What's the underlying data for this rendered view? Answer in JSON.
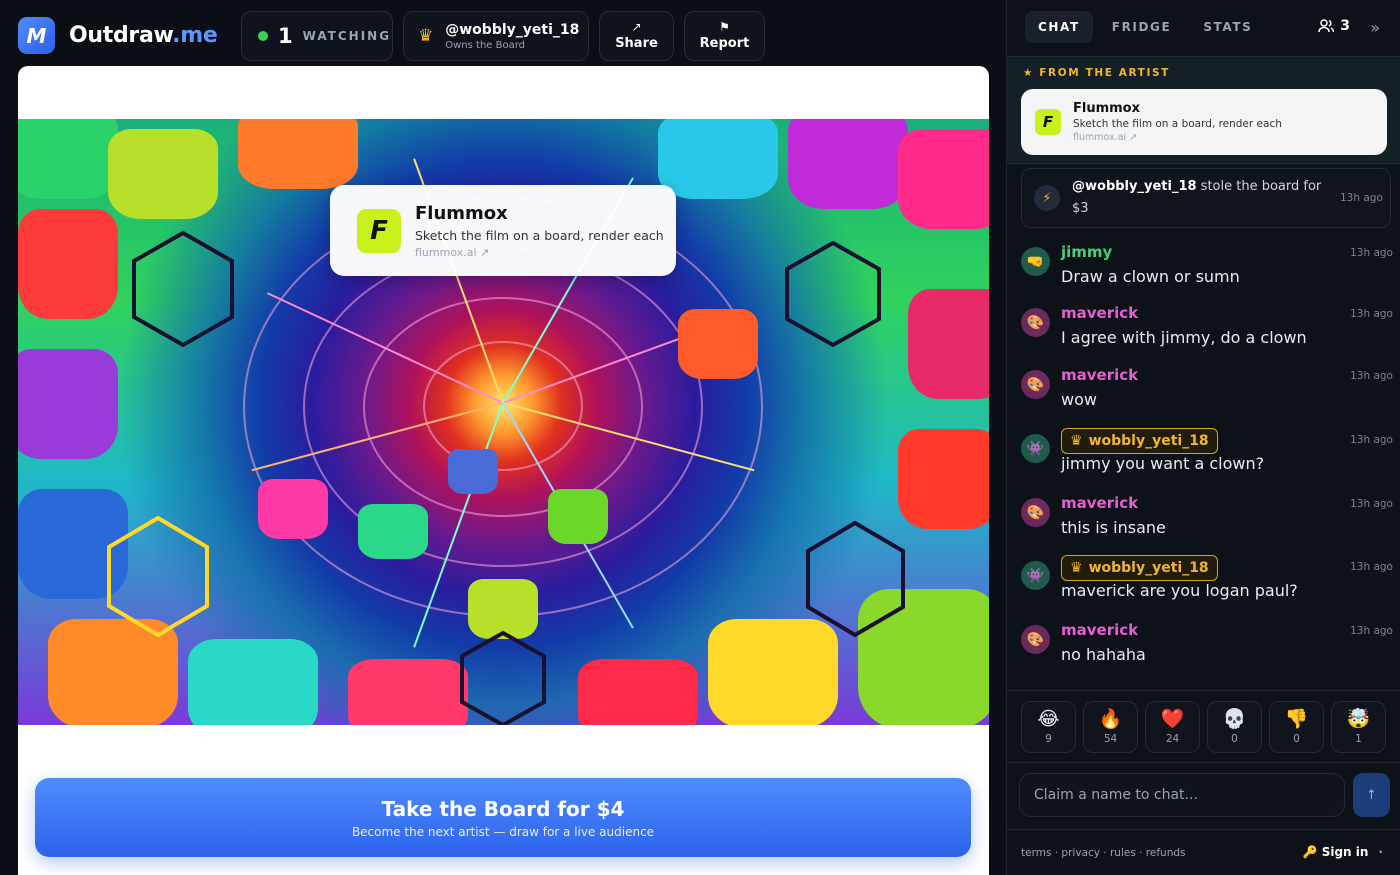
{
  "header": {
    "logo_mark": "M",
    "brand_main": "Outdraw",
    "brand_tld": ".me",
    "watch_count": "1",
    "watch_label": "WATCHING",
    "owner_name": "@wobbly_yeti_18",
    "owner_sub": "Owns the Board",
    "share_label": "Share",
    "report_label": "Report"
  },
  "sponsor": {
    "logo_letter": "F",
    "name": "Flummox",
    "desc": "Sketch the film on a board, render each",
    "link": "flummox.ai ↗"
  },
  "cta": {
    "title": "Take the Board for $4",
    "subtitle": "Become the next artist — draw for a live audience"
  },
  "sidebar": {
    "tabs": [
      "CHAT",
      "FRIDGE",
      "STATS"
    ],
    "viewer_count": "3",
    "from_artist": "FROM THE ARTIST",
    "artist_card": {
      "logo_letter": "F",
      "name": "Flummox",
      "desc": "Sketch the film on a board, render each",
      "link": "flummox.ai ↗"
    },
    "stole": {
      "user": "@wobbly_yeti_18",
      "text": " stole the board for $3",
      "time": "13h ago"
    },
    "messages": [
      {
        "user": "jimmy",
        "text": "Draw a clown or sumn",
        "time": "13h ago"
      },
      {
        "user": "maverick",
        "text": "I agree with jimmy, do a clown",
        "time": "13h ago"
      },
      {
        "user": "maverick",
        "text": "wow",
        "time": "13h ago"
      },
      {
        "user": "wobbly_yeti_18",
        "text": "jimmy you want a clown?",
        "time": "13h ago"
      },
      {
        "user": "maverick",
        "text": "this is insane",
        "time": "13h ago"
      },
      {
        "user": "wobbly_yeti_18",
        "text": "maverick are you logan paul?",
        "time": "13h ago"
      },
      {
        "user": "maverick",
        "text": "no hahaha",
        "time": "13h ago"
      }
    ],
    "reactions": [
      {
        "emoji": "😂",
        "count": "9"
      },
      {
        "emoji": "🔥",
        "count": "54"
      },
      {
        "emoji": "❤️",
        "count": "24"
      },
      {
        "emoji": "💀",
        "count": "0"
      },
      {
        "emoji": "👎",
        "count": "0"
      },
      {
        "emoji": "🤯",
        "count": "1"
      }
    ],
    "chat_placeholder": "Claim a name to chat...",
    "footer_links": "terms · privacy · rules · refunds",
    "sign_in": "Sign in",
    "sign_in_tail": "·"
  },
  "colors": {
    "accent": "#4f8cff",
    "gold": "#f1b62a",
    "jimmy": "#45d17a",
    "maverick": "#e560d4",
    "live_dot": "#3ecf5a"
  },
  "icons": {
    "share": "arrow-up-right-icon",
    "report": "flag-icon",
    "owner": "crown-icon",
    "viewers": "users-icon",
    "collapse": "double-chevron-right-icon",
    "send": "arrow-up-icon",
    "stole": "lightning-icon",
    "sign_in": "key-icon"
  }
}
